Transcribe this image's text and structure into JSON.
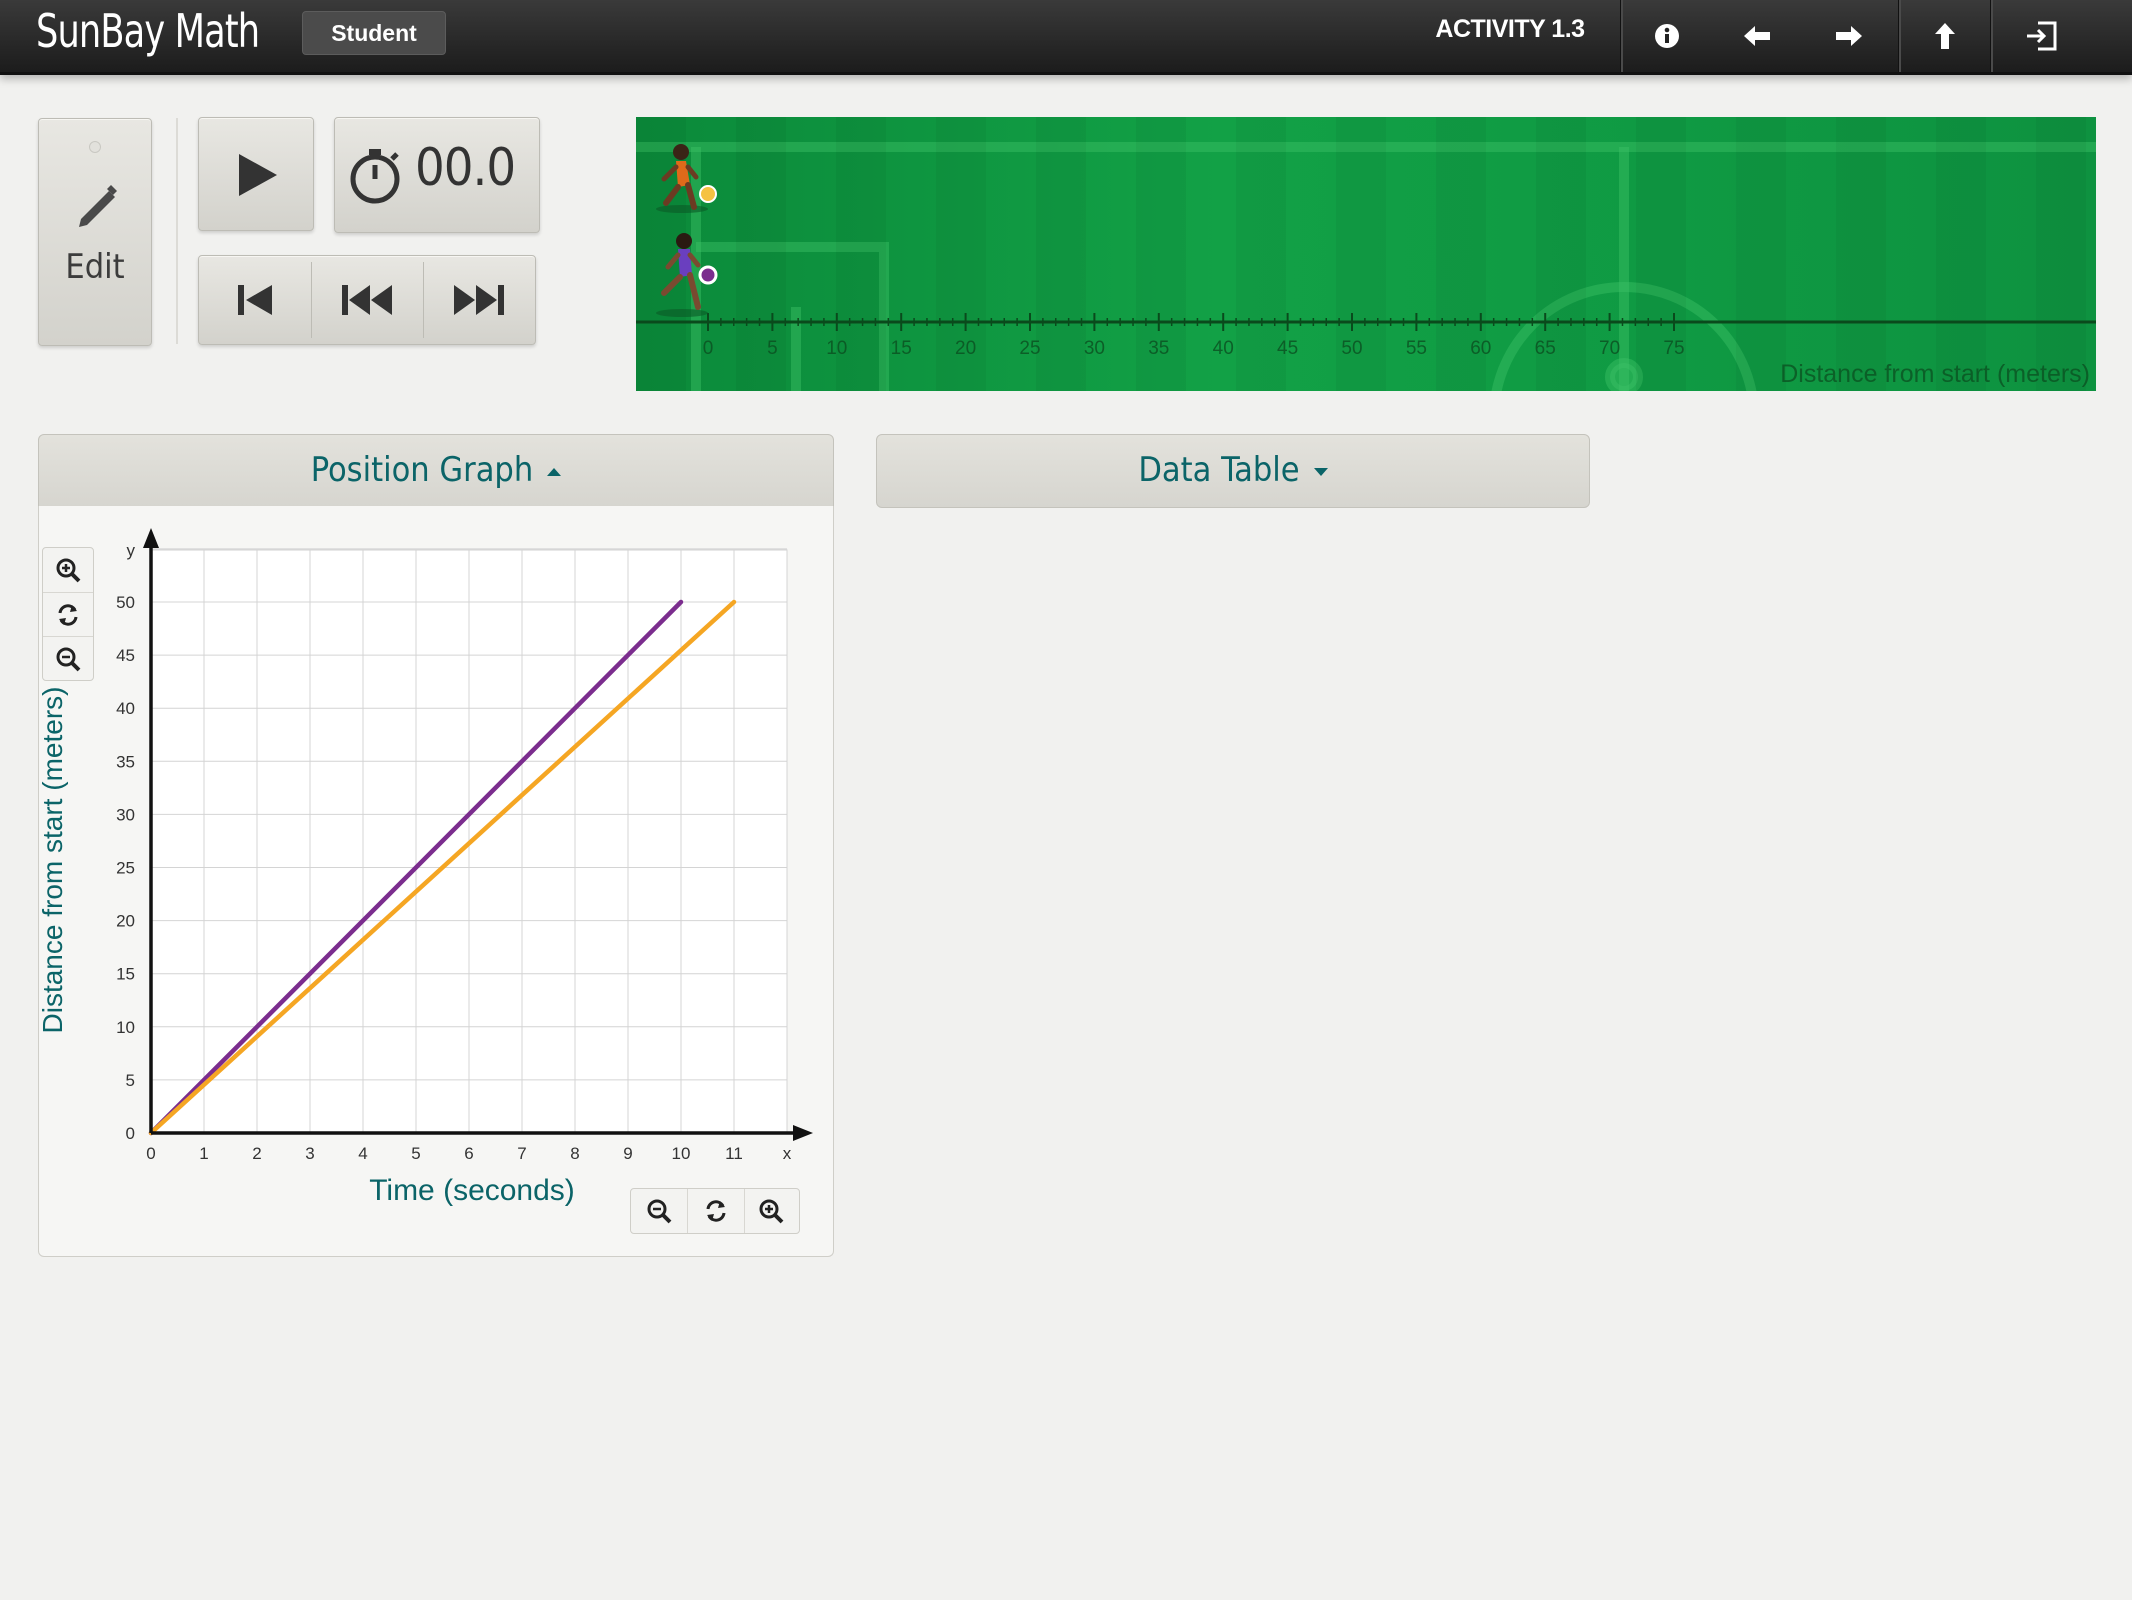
{
  "header": {
    "brand": "SunBay Math",
    "role_badge": "Student",
    "activity": "ACTIVITY 1.3",
    "icons": [
      "info-icon",
      "arrow-left-icon",
      "arrow-right-icon",
      "arrow-up-icon",
      "exit-icon"
    ]
  },
  "controls": {
    "edit_label": "Edit",
    "timer": "00.0",
    "icons": [
      "pencil-icon",
      "play-icon",
      "stopwatch-icon",
      "skip-to-start-icon",
      "rewind-icon",
      "fast-forward-icon"
    ]
  },
  "field": {
    "axis_label": "Distance from start (meters)",
    "ticks": [
      "0",
      "5",
      "10",
      "15",
      "20",
      "25",
      "30",
      "35",
      "40",
      "45",
      "50",
      "55",
      "60",
      "65",
      "70",
      "75"
    ],
    "runners": [
      {
        "name": "runner-orange",
        "position_m": 0,
        "color": "#f5a623"
      },
      {
        "name": "runner-purple",
        "position_m": 0,
        "color": "#7b2d8e"
      }
    ]
  },
  "panels": {
    "position_graph_title": "Position Graph",
    "data_table_title": "Data Table"
  },
  "chart_data": {
    "type": "line",
    "xlabel": "Time (seconds)",
    "ylabel": "Distance from start (meters)",
    "x_axis_letter": "x",
    "y_axis_letter": "y",
    "xlim": [
      0,
      12
    ],
    "ylim": [
      0,
      55
    ],
    "x_ticks": [
      0,
      1,
      2,
      3,
      4,
      5,
      6,
      7,
      8,
      9,
      10,
      11
    ],
    "y_ticks": [
      0,
      5,
      10,
      15,
      20,
      25,
      30,
      35,
      40,
      45,
      50
    ],
    "grid": true,
    "series": [
      {
        "color": "#7b2d8e",
        "points": [
          [
            0,
            0
          ],
          [
            10,
            50
          ]
        ]
      },
      {
        "color": "#f5a623",
        "points": [
          [
            0,
            0
          ],
          [
            11,
            50
          ]
        ]
      }
    ]
  },
  "colors": {
    "accent": "#0b6468",
    "field_green": "#12a146",
    "topbar": "#2a2a2a"
  }
}
